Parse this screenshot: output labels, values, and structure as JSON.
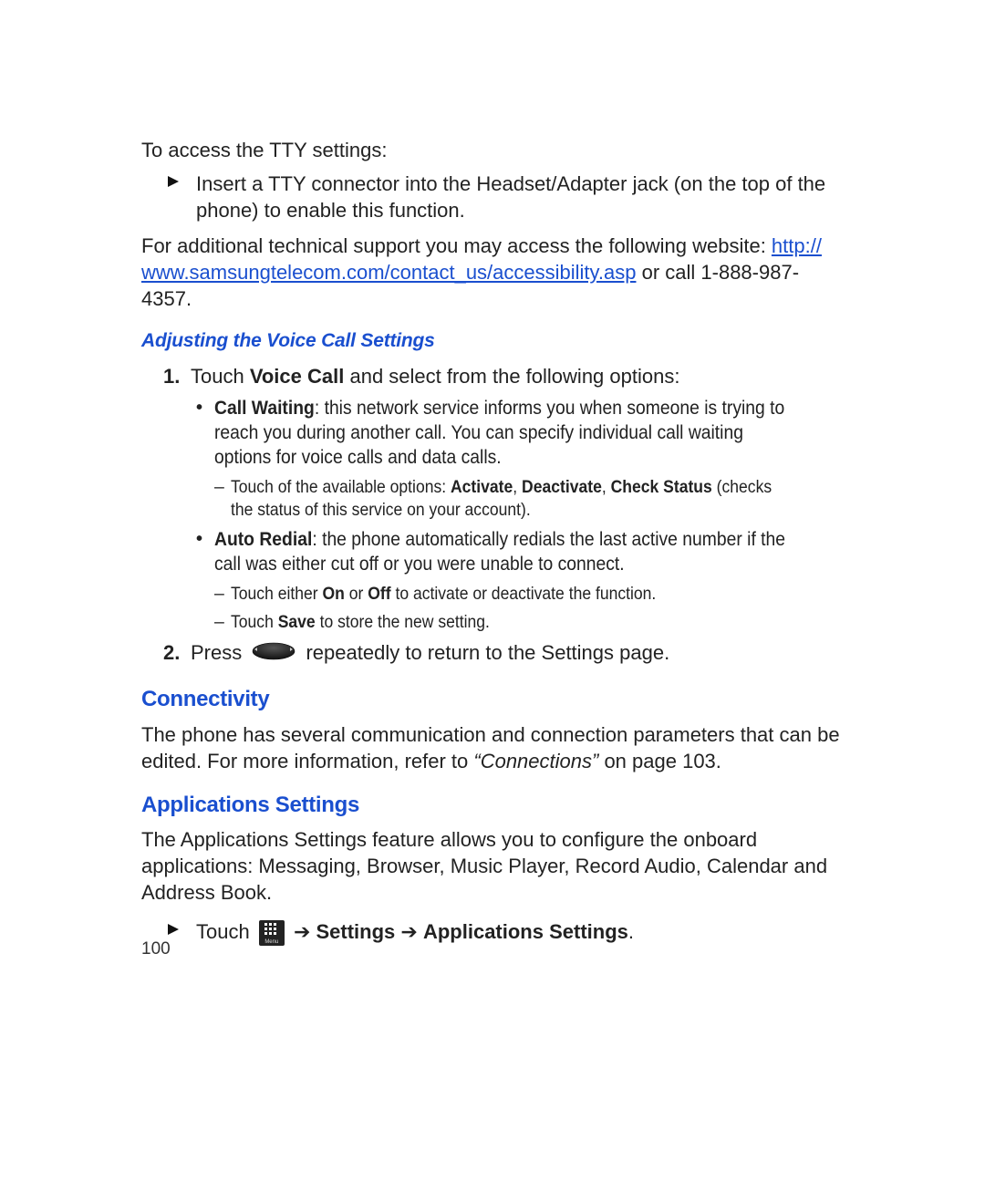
{
  "intro": "To access the TTY settings:",
  "tty_step": "Insert a TTY connector into the Headset/Adapter jack (on the top of the phone) to enable this function.",
  "support_pre": "For additional technical support you may access the following website: ",
  "support_link1": "http://",
  "support_link2": "www.samsungtelecom.com/contact_us/accessibility.asp",
  "support_post": " or call 1-888-987-4357.",
  "voice_subhead": "Adjusting the Voice Call Settings",
  "step1_num": "1.",
  "step1_a": "Touch ",
  "step1_b": "Voice Call",
  "step1_c": " and select from the following options:",
  "cw_label": "Call Waiting",
  "cw_text": ": this network service informs you when someone is trying to reach you during another call. You can specify individual call waiting options for voice calls and data calls.",
  "cw_dash_a": "Touch of the available options: ",
  "cw_dash_b1": "Activate",
  "cw_dash_sep": ", ",
  "cw_dash_b2": "Deactivate",
  "cw_dash_b3": "Check Status",
  "cw_dash_c": " (checks the status of this service on your account).",
  "ar_label": "Auto Redial",
  "ar_text": ": the phone automatically redials the last active number if the call was either cut off or you were unable to connect.",
  "ar_dash1_a": "Touch either ",
  "ar_dash1_b1": "On",
  "ar_dash1_mid": " or ",
  "ar_dash1_b2": "Off",
  "ar_dash1_c": " to activate or deactivate the function.",
  "ar_dash2_a": "Touch ",
  "ar_dash2_b": "Save",
  "ar_dash2_c": " to store the new setting.",
  "step2_num": "2.",
  "step2_a": "Press ",
  "step2_b": " repeatedly to return to the Settings page.",
  "connectivity_h": "Connectivity",
  "conn_a": "The phone has several communication and connection parameters that can be edited. For more information, refer to ",
  "conn_i": "“Connections”",
  "conn_b": "  on page 103.",
  "apps_h": "Applications Settings",
  "apps_body": "The Applications Settings feature allows you to configure the onboard applications: Messaging, Browser, Music Player, Record Audio, Calendar and Address Book.",
  "apps_step_a": "Touch ",
  "apps_step_arrow": " ➔ ",
  "apps_step_b1": "Settings",
  "apps_step_b2": "Applications Settings",
  "apps_step_period": ".",
  "menu_label": "Menu",
  "page_num": "100"
}
